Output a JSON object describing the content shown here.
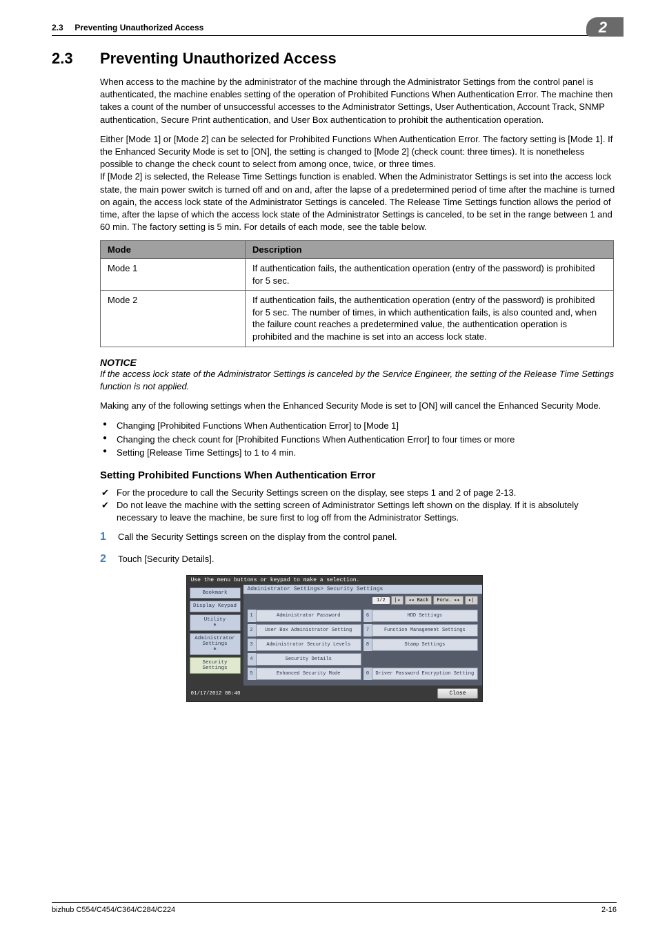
{
  "header": {
    "section_num_small": "2.3",
    "section_title_small": "Preventing Unauthorized Access",
    "chapter_badge": "2"
  },
  "section": {
    "num": "2.3",
    "title": "Preventing Unauthorized Access"
  },
  "para1": "When access to the machine by the administrator of the machine through the Administrator Settings from the control panel is authenticated, the machine enables setting of the operation of Prohibited Functions When Authentication Error. The machine then takes a count of the number of unsuccessful accesses to the Administrator Settings, User Authentication, Account Track, SNMP authentication, Secure Print authentication, and User Box authentication to prohibit the authentication operation.",
  "para2": "Either [Mode 1] or [Mode 2] can be selected for Prohibited Functions When Authentication Error. The factory setting is [Mode 1]. If the Enhanced Security Mode is set to [ON], the setting is changed to [Mode 2] (check count: three times). It is nonetheless possible to change the check count to select from among once, twice, or three times.",
  "para3": "If [Mode 2] is selected, the Release Time Settings function is enabled. When the Administrator Settings is set into the access lock state, the main power switch is turned off and on and, after the lapse of a predetermined period of time after the machine is turned on again, the access lock state of the Administrator Settings is canceled. The Release Time Settings function allows the period of time, after the lapse of which the access lock state of the Administrator Settings is canceled, to be set in the range between 1 and 60 min. The factory setting is 5 min. For details of each mode, see the table below.",
  "table": {
    "th_mode": "Mode",
    "th_desc": "Description",
    "rows": [
      {
        "mode": "Mode 1",
        "desc": "If authentication fails, the authentication operation (entry of the password) is prohibited for 5 sec."
      },
      {
        "mode": "Mode 2",
        "desc": "If authentication fails, the authentication operation (entry of the password) is prohibited for 5 sec. The number of times, in which authentication fails, is also counted and, when the failure count reaches a predetermined value, the authentication operation is prohibited and the machine is set into an access lock state."
      }
    ]
  },
  "notice": {
    "heading": "NOTICE",
    "text": "If the access lock state of the Administrator Settings is canceled by the Service Engineer, the setting of the Release Time Settings function is not applied."
  },
  "para4": "Making any of the following settings when the Enhanced Security Mode is set to [ON] will cancel the Enhanced Security Mode.",
  "bullets": [
    "Changing [Prohibited Functions When Authentication Error] to [Mode 1]",
    "Changing the check count for [Prohibited Functions When Authentication Error] to four times or more",
    "Setting [Release Time Settings] to 1 to 4 min."
  ],
  "sub_heading": "Setting Prohibited Functions When Authentication Error",
  "checks": [
    "For the procedure to call the Security Settings screen on the display, see steps 1 and 2 of page 2-13.",
    "Do not leave the machine with the setting screen of Administrator Settings left shown on the display. If it is absolutely necessary to leave the machine, be sure first to log off from the Administrator Settings."
  ],
  "steps": [
    {
      "num": "1",
      "text": "Call the Security Settings screen on the display from the control panel."
    },
    {
      "num": "2",
      "text": "Touch [Security Details]."
    }
  ],
  "screenshot": {
    "instruction": "Use the menu buttons or keypad to make a selection.",
    "left_tabs": {
      "bookmark": "Bookmark",
      "display_keypad": "Display Keypad",
      "utility": "Utility",
      "admin": "Administrator Settings",
      "security": "Security Settings"
    },
    "breadcrumb": "Administrator Settings> Security Settings",
    "page_indicator": "1/2",
    "back_btn": "Back",
    "forw_btn": "Forw.",
    "items": [
      {
        "n": "1",
        "label": "Administrator Password"
      },
      {
        "n": "6",
        "label": "HDD Settings"
      },
      {
        "n": "2",
        "label": "User Box Administrator Setting"
      },
      {
        "n": "7",
        "label": "Function Management Settings"
      },
      {
        "n": "3",
        "label": "Administrator Security Levels"
      },
      {
        "n": "8",
        "label": "Stamp Settings"
      },
      {
        "n": "4",
        "label": "Security Details"
      },
      {
        "n": "",
        "label": ""
      },
      {
        "n": "5",
        "label": "Enhanced Security Mode"
      },
      {
        "n": "0",
        "label": "Driver Password Encryption Setting"
      }
    ],
    "datetime": "01/17/2012   08:40",
    "close": "Close"
  },
  "footer": {
    "model": "bizhub C554/C454/C364/C284/C224",
    "page": "2-16"
  }
}
